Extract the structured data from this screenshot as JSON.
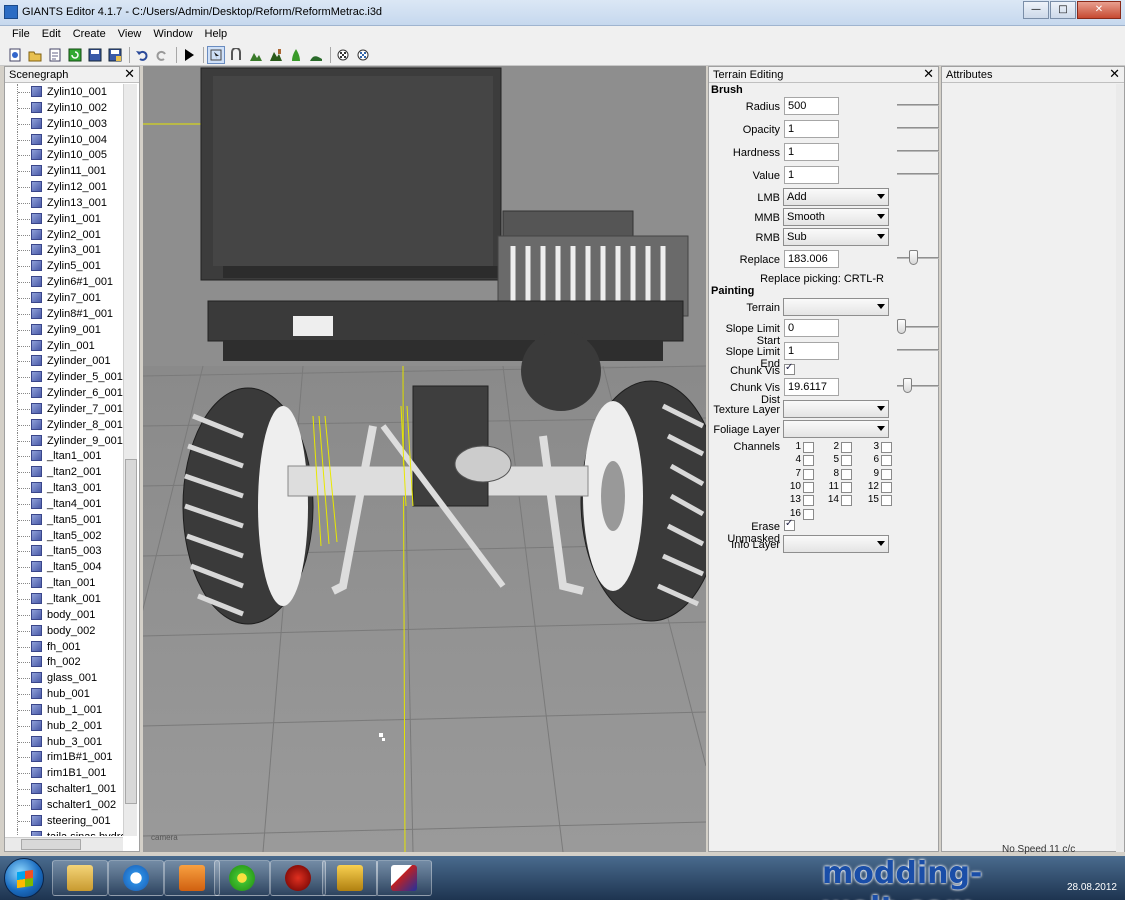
{
  "window": {
    "title": "GIANTS Editor 4.1.7 - C:/Users/Admin/Desktop/Reform/ReformMetrac.i3d"
  },
  "window_buttons": {
    "minimize": "—",
    "maximize": "□",
    "close": "✕"
  },
  "menu": [
    {
      "label": "File",
      "mnemonic": "F"
    },
    {
      "label": "Edit",
      "mnemonic": "E"
    },
    {
      "label": "Create",
      "mnemonic": "C"
    },
    {
      "label": "View",
      "mnemonic": "V"
    },
    {
      "label": "Window",
      "mnemonic": "W"
    },
    {
      "label": "Help",
      "mnemonic": "H"
    }
  ],
  "toolbar_icons": [
    "new-icon",
    "open-icon",
    "reload-icon",
    "refresh-icon",
    "save-icon",
    "save-as-icon",
    "undo-icon",
    "redo-icon",
    "play-icon",
    "select-mode-icon",
    "move-mode-icon",
    "terrain-sculpt-icon",
    "terrain-paint-icon",
    "foliage-paint-icon",
    "terrain-smooth-icon",
    "render-icon",
    "settings-icon"
  ],
  "scenegraph": {
    "title": "Scenegraph",
    "close": "✕",
    "items": [
      "Zylin10_001",
      "Zylin10_002",
      "Zylin10_003",
      "Zylin10_004",
      "Zylin10_005",
      "Zylin11_001",
      "Zylin12_001",
      "Zylin13_001",
      "Zylin1_001",
      "Zylin2_001",
      "Zylin3_001",
      "Zylin5_001",
      "Zylin6#1_001",
      "Zylin7_001",
      "Zylin8#1_001",
      "Zylin9_001",
      "Zylin_001",
      "Zylinder_001",
      "Zylinder_5_001",
      "Zylinder_6_001",
      "Zylinder_7_001",
      "Zylinder_8_001",
      "Zylinder_9_001",
      "_ltan1_001",
      "_ltan2_001",
      "_ltan3_001",
      "_ltan4_001",
      "_ltan5_001",
      "_ltan5_002",
      "_ltan5_003",
      "_ltan5_004",
      "_ltan_001",
      "_ltank_001",
      "body_001",
      "body_002",
      "fh_001",
      "fh_002",
      "glass_001",
      "hub_001",
      "hub_1_001",
      "hub_2_001",
      "hub_3_001",
      "rim1B#1_001",
      "rim1B1_001",
      "schalter1_001",
      "schalter1_002",
      "steering_001",
      "taila.sinas.hydro..."
    ]
  },
  "viewport": {
    "label": "camera"
  },
  "terrain_editing": {
    "title": "Terrain Editing",
    "close": "✕",
    "brush": {
      "section": "Brush",
      "radius_label": "Radius",
      "radius": "500",
      "opacity_label": "Opacity",
      "opacity": "1",
      "hardness_label": "Hardness",
      "hardness": "1",
      "value_label": "Value",
      "value": "1",
      "lmb_label": "LMB",
      "lmb": "Add",
      "mmb_label": "MMB",
      "mmb": "Smooth",
      "rmb_label": "RMB",
      "rmb": "Sub",
      "replace_label": "Replace",
      "replace": "183.006",
      "replace_hint": "Replace picking: CRTL-R"
    },
    "painting": {
      "section": "Painting",
      "terrain_label": "Terrain",
      "terrain": "",
      "slope_start_label": "Slope Limit Start",
      "slope_start": "0",
      "slope_end_label": "Slope Limit End",
      "slope_end": "1",
      "chunk_vis_label": "Chunk Vis",
      "chunk_vis": true,
      "chunk_vis_dist_label": "Chunk Vis Dist",
      "chunk_vis_dist": "19.6117",
      "texture_layer_label": "Texture Layer",
      "texture_layer": "",
      "foliage_layer_label": "Foliage Layer",
      "foliage_layer": "",
      "channels_label": "Channels",
      "channels": [
        "1",
        "2",
        "3",
        "4",
        "5",
        "6",
        "7",
        "8",
        "9",
        "10",
        "11",
        "12",
        "13",
        "14",
        "15",
        "16"
      ],
      "erase_unmasked_label": "Erase Unmasked",
      "erase_unmasked": true,
      "info_layer_label": "Info Layer",
      "info_layer": ""
    }
  },
  "attributes": {
    "title": "Attributes",
    "close": "✕"
  },
  "status_partial": "No Speed 11 c/c",
  "taskbar": {
    "date": "28.08.2012",
    "apps": [
      "explorer-icon",
      "internet-explorer-icon",
      "media-player-icon",
      "icq-icon",
      "game-icon",
      "archive-icon",
      "giants-editor-icon"
    ]
  },
  "watermark": "modding-welt.com"
}
